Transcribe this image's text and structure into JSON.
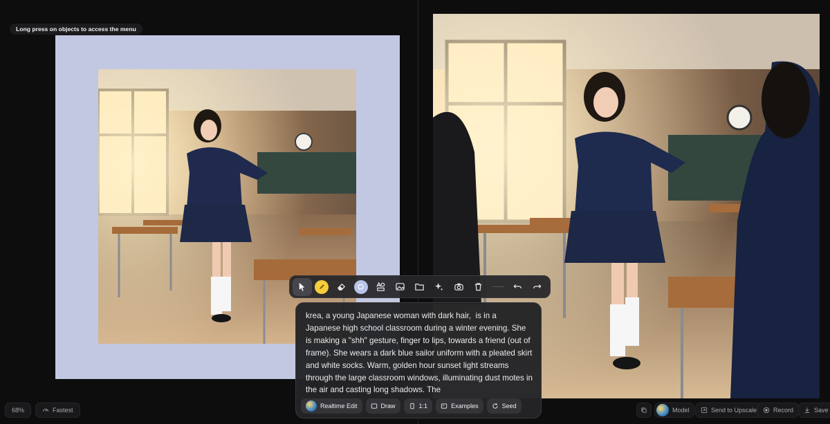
{
  "hint": "Long press on objects to access the menu",
  "colors": {
    "canvas_background": "#c2c8e1",
    "pen_color": "#f4ce3c",
    "shape_color": "#b8c3e8"
  },
  "toolbar": {
    "tools": [
      {
        "name": "select-tool",
        "icon": "cursor-icon"
      },
      {
        "name": "pen-tool",
        "icon": "pen-icon"
      },
      {
        "name": "eraser-tool",
        "icon": "eraser-icon"
      },
      {
        "name": "shape-tool",
        "icon": "circle-icon"
      },
      {
        "name": "text-shapes-tool",
        "icon": "text-shapes-icon"
      },
      {
        "name": "image-tool",
        "icon": "image-icon"
      },
      {
        "name": "folder-tool",
        "icon": "folder-icon"
      },
      {
        "name": "sparkle-tool",
        "icon": "sparkles-icon"
      },
      {
        "name": "camera-tool",
        "icon": "camera-icon"
      },
      {
        "name": "delete-tool",
        "icon": "trash-icon"
      },
      {
        "name": "undo-tool",
        "icon": "undo-icon"
      },
      {
        "name": "redo-tool",
        "icon": "redo-icon"
      }
    ]
  },
  "prompt": {
    "text": "krea, a young Japanese woman with dark hair,  is in a Japanese high school classroom during a winter evening. She is making a \"shh\" gesture, finger to lips, towards a friend (out of frame). She wears a dark blue sailor uniform with a pleated skirt and white socks. Warm, golden hour sunset light streams through the large classroom windows, illuminating dust motes in the air and casting long shadows. The",
    "actions": {
      "realtime_edit": "Realtime Edit",
      "draw": "Draw",
      "aspect": "1:1",
      "examples": "Examples",
      "seed": "Seed"
    }
  },
  "bottom_left": {
    "zoom": "68%",
    "speed": "Fastest"
  },
  "bottom_right": {
    "model": "Model",
    "upscale": "Send to Upscale",
    "record": "Record",
    "save": "Save"
  }
}
